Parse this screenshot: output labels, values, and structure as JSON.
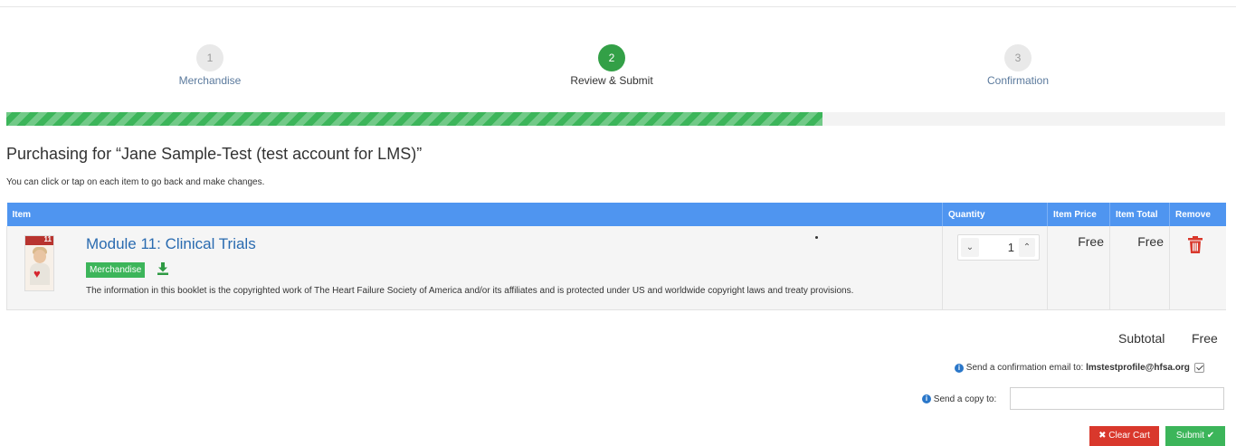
{
  "steps": [
    {
      "number": "1",
      "label": "Merchandise",
      "state": "inactive"
    },
    {
      "number": "2",
      "label": "Review & Submit",
      "state": "active"
    },
    {
      "number": "3",
      "label": "Confirmation",
      "state": "inactive"
    }
  ],
  "progress": {
    "fraction": 0.67,
    "color": "#3cb55a"
  },
  "heading": "Purchasing for “Jane Sample-Test (test account for LMS)”",
  "hint": "You can click or tap on each item to go back and make changes.",
  "table": {
    "headers": {
      "item": "Item",
      "quantity": "Quantity",
      "price": "Item Price",
      "total": "Item Total",
      "remove": "Remove"
    },
    "header_color": "#4f95f0",
    "rows": [
      {
        "thumbnail_number": "11",
        "title": "Module 11: Clinical Trials",
        "tag": "Merchandise",
        "download_icon": "download-icon",
        "description": "The information in this booklet is the copyrighted work of The Heart Failure Society of America and/or its affiliates and is protected under US and worldwide copyright laws and treaty provisions.",
        "quantity": "1",
        "price": "Free",
        "total": "Free",
        "remove_icon": "trash-icon"
      }
    ]
  },
  "summary": {
    "subtotal_label": "Subtotal",
    "subtotal_value": "Free"
  },
  "confirmation": {
    "label": "Send a confirmation email to:",
    "email": "lmstestprofile@hfsa.org",
    "checked": true
  },
  "copy": {
    "label": "Send a copy to:",
    "value": ""
  },
  "buttons": {
    "clear": "Clear Cart",
    "submit": "Submit",
    "clear_color": "#d9382c",
    "submit_color": "#3cb55a"
  }
}
